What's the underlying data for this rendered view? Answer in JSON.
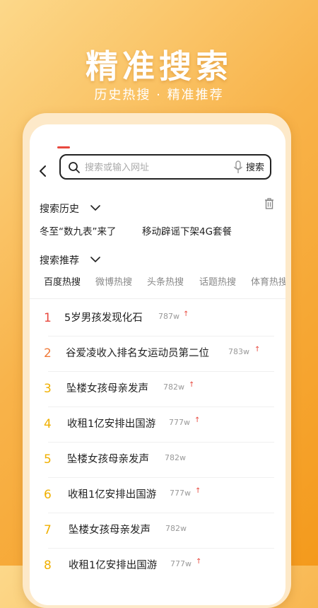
{
  "promo": {
    "title": "精准搜索",
    "subtitle": "历史热搜 · 精准推荐"
  },
  "search": {
    "placeholder": "搜索或输入网址",
    "button_label": "搜索"
  },
  "history": {
    "title": "搜索历史",
    "items": [
      "冬至“数九表”来了",
      "移动辟谣下架4G套餐"
    ]
  },
  "recommend": {
    "title": "搜索推荐"
  },
  "tabs": [
    "百度热搜",
    "微博热搜",
    "头条热搜",
    "话题热搜",
    "体育热搜"
  ],
  "hot_list": [
    {
      "rank": "1",
      "title": "5岁男孩发现化石",
      "count": "787w",
      "arrow": "↑"
    },
    {
      "rank": "2",
      "title": "谷爱凌收入排名女运动员第二位",
      "count": "783w",
      "arrow": "↑"
    },
    {
      "rank": "3",
      "title": "坠楼女孩母亲发声",
      "count": "782w",
      "arrow": "↑"
    },
    {
      "rank": "4",
      "title": "收租1亿安排出国游",
      "count": "777w",
      "arrow": "↑"
    },
    {
      "rank": "5",
      "title": "坠楼女孩母亲发声",
      "count": "782w",
      "arrow": ""
    },
    {
      "rank": "6",
      "title": "收租1亿安排出国游",
      "count": "777w",
      "arrow": "↑"
    },
    {
      "rank": "7",
      "title": "坠楼女孩母亲发声",
      "count": "782w",
      "arrow": ""
    },
    {
      "rank": "8",
      "title": "收租1亿安排出国游",
      "count": "777w",
      "arrow": "↑"
    }
  ],
  "colors": {
    "accent_red": "#e8483e",
    "rank_1": "#e8483e",
    "rank_2": "#f07a3a",
    "rank_3_plus": "#f0b000",
    "background_orange": "#f49a1c"
  },
  "icons": {
    "back": "back-icon",
    "search": "search-icon",
    "mic": "mic-icon",
    "trash": "trash-icon",
    "chevron": "chevron-down-icon"
  }
}
